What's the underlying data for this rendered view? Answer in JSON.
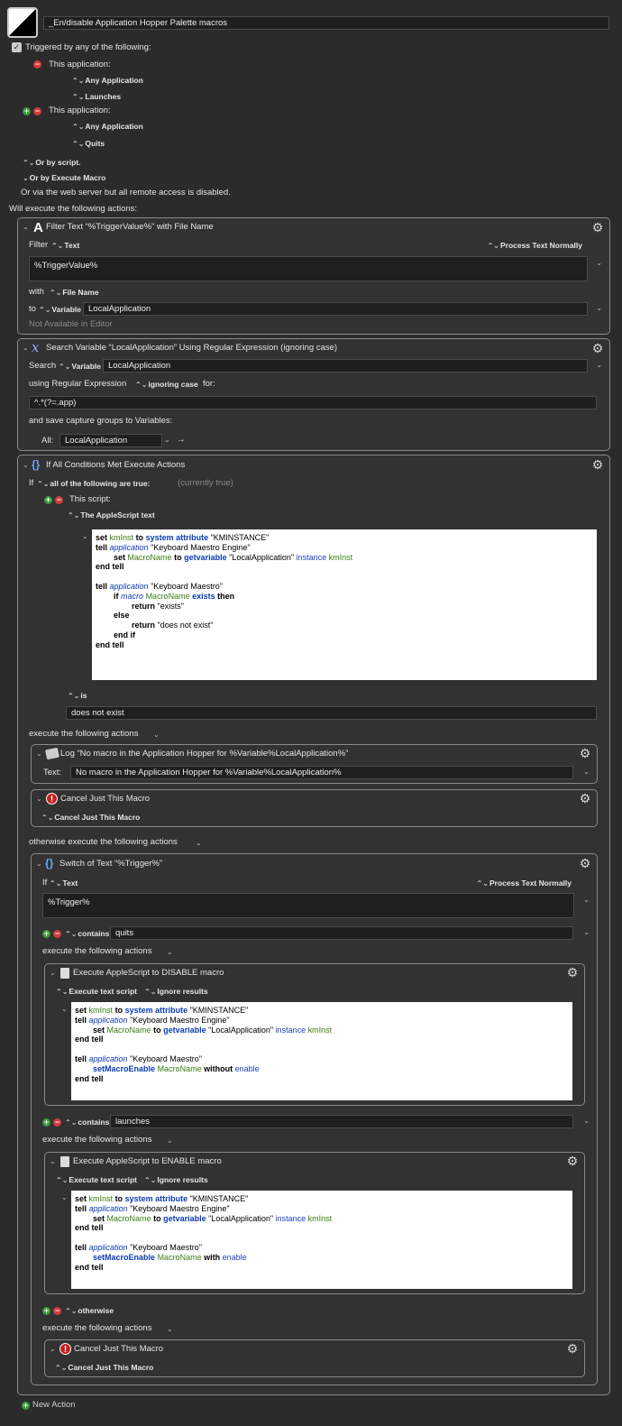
{
  "macro": {
    "name": "_En/disable Application Hopper Palette macros"
  },
  "trigger": {
    "label": "Triggered by any of the following:",
    "t1": {
      "label": "This application:",
      "app": "Any Application",
      "event": "Launches"
    },
    "t2": {
      "label": "This application:",
      "app": "Any Application",
      "event": "Quits"
    },
    "or_script": "Or by script.",
    "or_execute": "Or by Execute Macro",
    "web": "Or via the web server but all remote access is disabled."
  },
  "will_execute": "Will execute the following actions:",
  "filter": {
    "title": "Filter Text “%TriggerValue%” with File Name",
    "filter_label": "Filter",
    "source": "Text",
    "process": "Process Text Normally",
    "text": "%TriggerValue%",
    "with_label": "with",
    "with_value": "File Name",
    "to_label": "to",
    "to_type": "Variable",
    "to_value": "LocalApplication",
    "not_available": "Not Available in Editor"
  },
  "search": {
    "title": "Search Variable “LocalApplication” Using Regular Expression (ignoring case)",
    "search_label": "Search",
    "type": "Variable",
    "variable": "LocalApplication",
    "using": "using Regular Expression",
    "case": "ignoring case",
    "for": "for:",
    "regex": "^.*(?=.app)",
    "save": "and save capture groups to Variables:",
    "all_label": "All:",
    "all_value": "LocalApplication"
  },
  "ifblock": {
    "title": "If All Conditions Met Execute Actions",
    "if_label": "If",
    "condition_mode": "all of the following are true:",
    "current": "(currently true)",
    "this_script": "This script:",
    "script_type": "The AppleScript text",
    "is": "is",
    "is_value": "does not exist",
    "execute": "execute the following actions",
    "otherwise": "otherwise execute the following actions"
  },
  "log": {
    "title": "Log “No macro in the Application Hopper for %Variable%LocalApplication%”",
    "text_label": "Text:",
    "text": "No macro in the Application Hopper for %Variable%LocalApplication%"
  },
  "cancel1": {
    "title": "Cancel Just This Macro",
    "option": "Cancel Just This Macro"
  },
  "switch": {
    "title": "Switch of Text “%Trigger%”",
    "if_label": "If",
    "source": "Text",
    "process": "Process Text Normally",
    "text": "%Trigger%",
    "case1": {
      "op": "contains",
      "value": "quits"
    },
    "case2": {
      "op": "contains",
      "value": "launches"
    },
    "case3": {
      "op": "otherwise"
    },
    "execute": "execute the following actions"
  },
  "disable": {
    "title": "Execute AppleScript to DISABLE macro",
    "opt1": "Execute text script",
    "opt2": "Ignore results"
  },
  "enable": {
    "title": "Execute AppleScript to ENABLE macro",
    "opt1": "Execute text script",
    "opt2": "Ignore results"
  },
  "cancel2": {
    "title": "Cancel Just This Macro",
    "option": "Cancel Just This Macro"
  },
  "new_action": "New Action",
  "colors": {
    "background": "#2b2b2b",
    "box_border": "#8a8a8a",
    "keyword_blue": "#0a3bb5",
    "var_green": "#3b7d12",
    "plus": "#3a9a3a",
    "minus": "#d23c3c"
  },
  "icons": [
    "gear-icon",
    "plus-icon",
    "minus-icon",
    "updown-icon",
    "chevron-down-icon",
    "stop-icon",
    "log-icon",
    "document-icon"
  ]
}
